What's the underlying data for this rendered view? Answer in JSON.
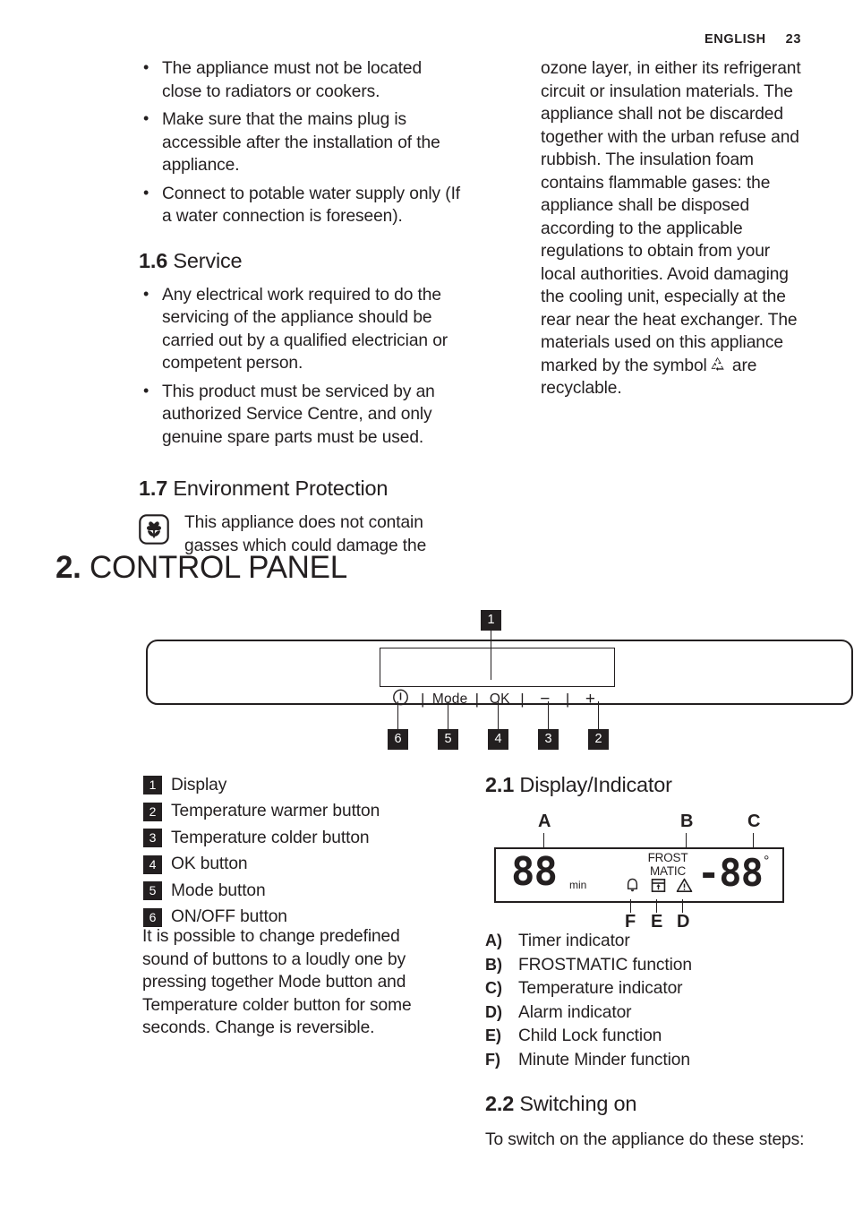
{
  "header": {
    "language": "ENGLISH",
    "page_number": "23"
  },
  "left_column": {
    "bullets": [
      "The appliance must not be located close to radiators or cookers.",
      "Make sure that the mains plug is accessible after the installation of the appliance.",
      "Connect to potable water supply only (If a water connection is foreseen)."
    ],
    "service": {
      "number": "1.6",
      "title": "Service",
      "bullets": [
        "Any electrical work required to do the servicing of the appliance should be carried out by a qualified electrician or competent person.",
        "This product must be serviced by an authorized Service Centre, and only genuine spare parts must be used."
      ]
    },
    "environment": {
      "number": "1.7",
      "title": "Environment Protection",
      "icon": "flower-icon",
      "text": "This appliance does not contain gasses which could damage the"
    }
  },
  "right_column": {
    "text_before_symbol": "ozone layer, in either its refrigerant circuit or insulation materials. The appliance shall not be discarded together with the urban refuse and rubbish. The insulation foam contains flammable gases: the appliance shall be disposed according to the applicable regulations to obtain from your local authorities. Avoid damaging the cooling unit, especially at the rear near the heat exchanger. The materials used on this appliance marked by the symbol",
    "symbol": "recycle-icon",
    "text_after_symbol": "are recyclable."
  },
  "chapter": {
    "number": "2.",
    "title": "CONTROL PANEL"
  },
  "panel_figure": {
    "buttons": [
      {
        "label": "power-icon",
        "callout": "6"
      },
      {
        "label": "Mode",
        "callout": "5"
      },
      {
        "label": "OK",
        "callout": "4"
      },
      {
        "label": "−",
        "callout": "3"
      },
      {
        "label": "+",
        "callout": "2"
      }
    ],
    "display_callout": "1"
  },
  "panel_legend": [
    {
      "num": "1",
      "label": "Display"
    },
    {
      "num": "2",
      "label": "Temperature warmer button"
    },
    {
      "num": "3",
      "label": "Temperature colder button"
    },
    {
      "num": "4",
      "label": "OK button"
    },
    {
      "num": "5",
      "label": "Mode button"
    },
    {
      "num": "6",
      "label": "ON/OFF button"
    }
  ],
  "panel_note": "It is possible to change predefined sound of buttons to a loudly one by pressing together Mode button and Temperature colder button for some seconds. Change is reversible.",
  "section_21": {
    "number": "2.1",
    "title": "Display/Indicator",
    "figure": {
      "labels_top": [
        "A",
        "B",
        "C"
      ],
      "labels_bottom": [
        "F",
        "E",
        "D"
      ],
      "timer_digits": "88",
      "timer_unit": "min",
      "frostmatic_line1": "FROST",
      "frostmatic_line2": "MATIC",
      "temperature_value": "-88",
      "degree_symbol": "°",
      "icons": [
        "bell-icon",
        "child-lock-icon",
        "warning-triangle-icon"
      ]
    },
    "legend": [
      {
        "key": "A)",
        "label": "Timer indicator"
      },
      {
        "key": "B)",
        "label": "FROSTMATIC function"
      },
      {
        "key": "C)",
        "label": "Temperature indicator"
      },
      {
        "key": "D)",
        "label": "Alarm indicator"
      },
      {
        "key": "E)",
        "label": "Child Lock function"
      },
      {
        "key": "F)",
        "label": "Minute Minder function"
      }
    ]
  },
  "section_22": {
    "number": "2.2",
    "title": "Switching on",
    "text": "To switch on the appliance do these steps:"
  },
  "colors": {
    "ink": "#231f20",
    "paper": "#ffffff"
  }
}
